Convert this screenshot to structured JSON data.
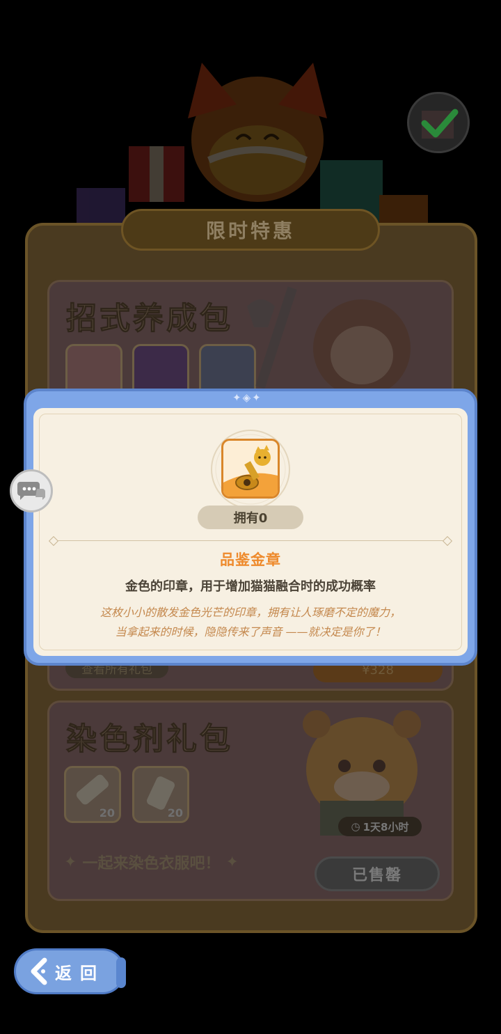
{
  "background": {
    "banner_title": "限时特惠",
    "pack1_title": "招式养成包",
    "view_all_label": "查看所有礼包",
    "price_label": "¥328",
    "pack2_title": "染色剂礼包",
    "dye_slot_counts": [
      "20",
      "20"
    ],
    "timer": "1天8小时",
    "slogan": "一起来染色衣服吧！",
    "soldout_label": "已售罄"
  },
  "modal": {
    "owned_label": "拥有0",
    "item_name": "品鉴金章",
    "item_desc": "金色的印章，用于增加猫猫融合时的成功概率",
    "flavor_line1": "这枚小小的散发金色光芒的印章，拥有让人琢磨不定的魔力，",
    "flavor_line2": "当拿起来的时候，隐隐传来了声音 ——就决定是你了！"
  },
  "nav": {
    "back_label": "返回"
  },
  "colors": {
    "modal_frame": "#7ea6e8",
    "modal_bg": "#f7f0e2",
    "item_name": "#ee8a2c",
    "flavor": "#c4884d",
    "back_button": "#7aa2e0"
  }
}
